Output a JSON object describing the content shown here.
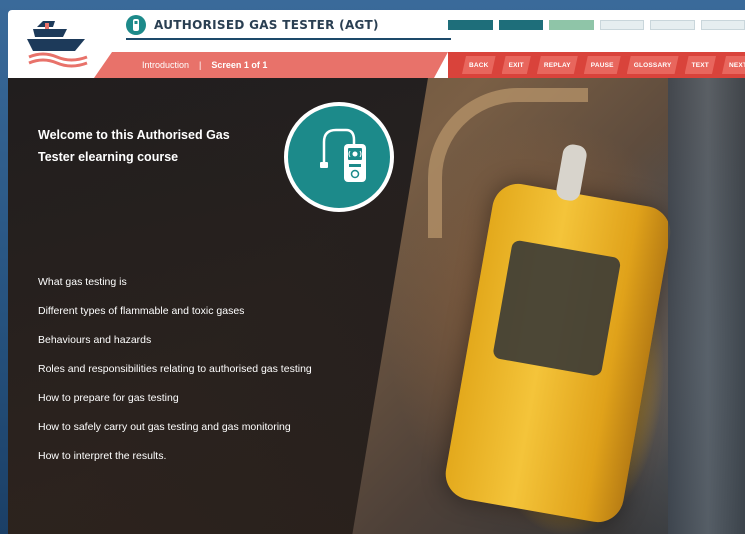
{
  "header": {
    "title": "AUTHORISED GAS TESTER (AGT)",
    "breadcrumb": {
      "section": "Introduction",
      "separator": "|",
      "screen": "Screen 1 of 1"
    },
    "progress": [
      "done",
      "done",
      "current",
      "todo",
      "todo",
      "todo"
    ],
    "nav": {
      "back": "BACK",
      "exit": "EXIT",
      "replay": "REPLAY",
      "pause": "PAUSE",
      "glossary": "GLOSSARY",
      "text": "TEXT",
      "next": "NEXT"
    }
  },
  "main": {
    "welcome_line1": "Welcome to this Authorised Gas",
    "welcome_line2": "Tester elearning course",
    "icon": "gas-detector-icon",
    "topics": [
      "What gas testing is",
      "Different types of flammable and toxic gases",
      "Behaviours and hazards",
      "Roles and responsibilities relating to authorised gas testing",
      "How to prepare for gas testing",
      "How to safely carry out gas testing and gas monitoring",
      "How to interpret the results."
    ]
  },
  "colors": {
    "teal": "#1c8a8a",
    "coral": "#e8726a",
    "nav_red": "#d9433b",
    "navy": "#1d4a6a"
  }
}
